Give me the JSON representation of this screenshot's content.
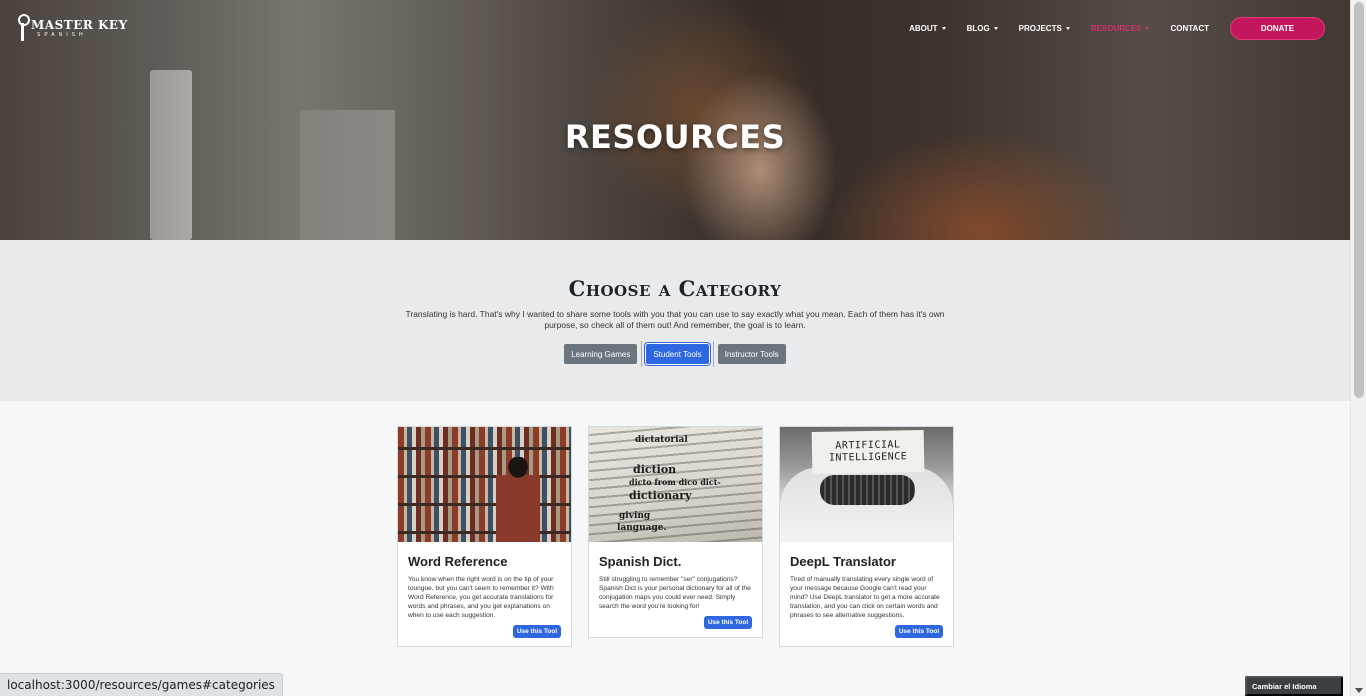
{
  "logo": {
    "main": "MASTER KEY",
    "sub": "SPANISH"
  },
  "nav": {
    "items": [
      {
        "label": "ABOUT",
        "dropdown": true
      },
      {
        "label": "BLOG",
        "dropdown": true
      },
      {
        "label": "PROJECTS",
        "dropdown": true
      },
      {
        "label": "RESOURCES",
        "dropdown": true,
        "active": true
      },
      {
        "label": "CONTACT",
        "dropdown": false
      }
    ],
    "donate_label": "DONATE"
  },
  "hero": {
    "title": "RESOURCES"
  },
  "category": {
    "title": "Choose a Category",
    "description": "Translating is hard. That's why I wanted to share some tools with you that you can use to say exactly what you mean. Each of them has it's own purpose, so check all of them out! And remember, the goal is to learn.",
    "buttons": [
      {
        "label": "Learning Games",
        "active": false
      },
      {
        "label": "Student Tools",
        "active": true
      },
      {
        "label": "Instructor Tools",
        "active": false
      }
    ]
  },
  "cards": [
    {
      "title": "Word Reference",
      "text": "You know when the right word is on the tip of your toungue, but you can't seem to remember it? With Word Reference, you get accurate translations for words and phrases, and you get explanations on when to use each suggestion.",
      "button": "Use this Tool"
    },
    {
      "title": "Spanish Dict.",
      "text": "Still struggling to remember \"ser\" conjugations? Spanish Dict is your personal dictionary for all of the conjugation maps you could ever need. Simply search the word you're looking for!",
      "button": "Use this Tool"
    },
    {
      "title": "DeepL Translator",
      "text": "Tired of manually translating every single word of your message because Google can't read your mind? Use DeepL translator to get a more accurate translation, and you can click on certain words and phrases to see alternative suggestions.",
      "button": "Use this Tool"
    }
  ],
  "image_text": {
    "dict_words": [
      "dictatorial",
      "diction",
      "dicto from dico dict-",
      "dictionary",
      "giving",
      "language."
    ],
    "ai_paper": [
      "ARTIFICIAL",
      "INTELLIGENCE"
    ]
  },
  "status_url": "localhost:3000/resources/games#categories",
  "language_button": "Cambiar el Idioma",
  "colors": {
    "accent": "#c2185b",
    "primary": "#2f67e0",
    "secondary": "#6c757d"
  }
}
